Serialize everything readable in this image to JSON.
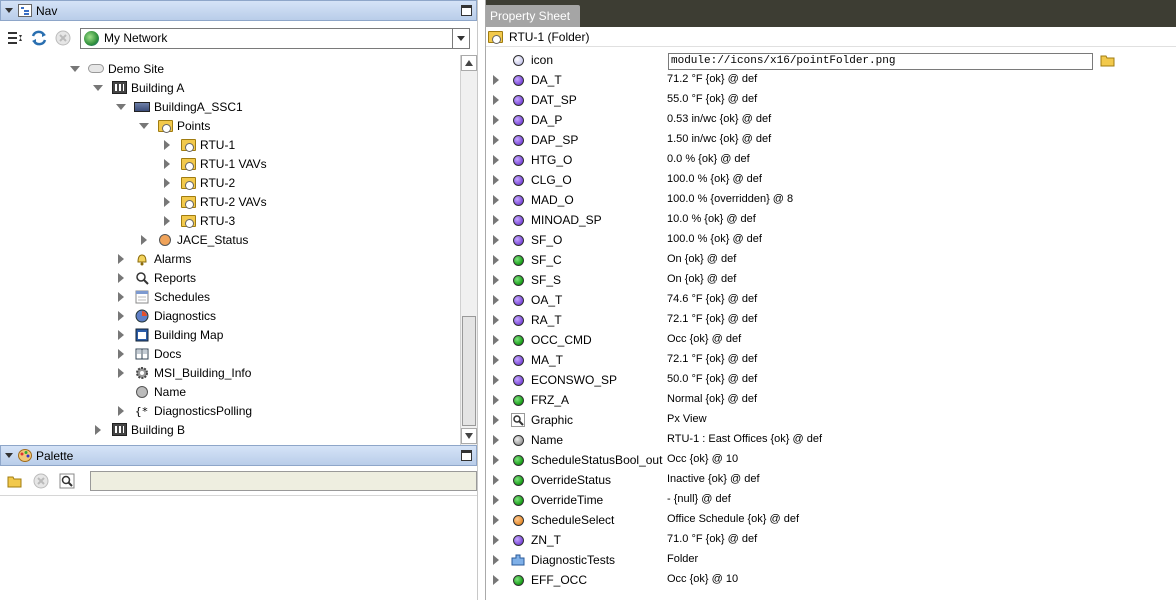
{
  "nav": {
    "title": "Nav",
    "network_label": "My Network",
    "tree": [
      {
        "label": "Demo Site",
        "indent": 0,
        "twisty": "open",
        "icon": "cloud-icon"
      },
      {
        "label": "Building A",
        "indent": 1,
        "twisty": "open",
        "icon": "building-icon"
      },
      {
        "label": "BuildingA_SSC1",
        "indent": 2,
        "twisty": "open",
        "icon": "station-icon"
      },
      {
        "label": "Points",
        "indent": 3,
        "twisty": "open",
        "icon": "folder-icon"
      },
      {
        "label": "RTU-1",
        "indent": 4,
        "twisty": "closed",
        "icon": "folder-icon"
      },
      {
        "label": "RTU-1 VAVs",
        "indent": 4,
        "twisty": "closed",
        "icon": "folder-icon"
      },
      {
        "label": "RTU-2",
        "indent": 4,
        "twisty": "closed",
        "icon": "folder-icon"
      },
      {
        "label": "RTU-2 VAVs",
        "indent": 4,
        "twisty": "closed",
        "icon": "folder-icon"
      },
      {
        "label": "RTU-3",
        "indent": 4,
        "twisty": "closed",
        "icon": "folder-icon"
      },
      {
        "label": "JACE_Status",
        "indent": 3,
        "twisty": "closed",
        "icon": "orange-dot-icon"
      },
      {
        "label": "Alarms",
        "indent": 2,
        "twisty": "closed",
        "icon": "bell-icon"
      },
      {
        "label": "Reports",
        "indent": 2,
        "twisty": "closed",
        "icon": "magnifier-icon"
      },
      {
        "label": "Schedules",
        "indent": 2,
        "twisty": "closed",
        "icon": "calendar-icon"
      },
      {
        "label": "Diagnostics",
        "indent": 2,
        "twisty": "closed",
        "icon": "clock-icon"
      },
      {
        "label": "Building Map",
        "indent": 2,
        "twisty": "closed",
        "icon": "map-icon"
      },
      {
        "label": "Docs",
        "indent": 2,
        "twisty": "closed",
        "icon": "book-icon"
      },
      {
        "label": "MSI_Building_Info",
        "indent": 2,
        "twisty": "closed",
        "icon": "gear-icon"
      },
      {
        "label": "Name",
        "indent": 2,
        "twisty": "none",
        "icon": "gray-dot-icon"
      },
      {
        "label": "DiagnosticsPolling",
        "indent": 2,
        "twisty": "closed",
        "icon": "program-icon"
      },
      {
        "label": "Building B",
        "indent": 1,
        "twisty": "closed",
        "icon": "building-icon"
      }
    ]
  },
  "palette": {
    "title": "Palette",
    "search_value": ""
  },
  "property_sheet": {
    "tab_label": "Property Sheet",
    "title": "RTU-1  (Folder)",
    "icon_row": {
      "name": "icon",
      "value": "module://icons/x16/pointFolder.png"
    },
    "rows": [
      {
        "name": "DA_T",
        "value": "71.2 °F {ok} @ def",
        "dot": "purple"
      },
      {
        "name": "DAT_SP",
        "value": "55.0 °F {ok} @ def",
        "dot": "purple"
      },
      {
        "name": "DA_P",
        "value": "0.53 in/wc {ok} @ def",
        "dot": "purple"
      },
      {
        "name": "DAP_SP",
        "value": "1.50 in/wc {ok} @ def",
        "dot": "purple"
      },
      {
        "name": "HTG_O",
        "value": "0.0 % {ok} @ def",
        "dot": "purple"
      },
      {
        "name": "CLG_O",
        "value": "100.0 % {ok} @ def",
        "dot": "purple"
      },
      {
        "name": "MAD_O",
        "value": "100.0 % {overridden} @ 8",
        "dot": "purple"
      },
      {
        "name": "MINOAD_SP",
        "value": "10.0 % {ok} @ def",
        "dot": "purple"
      },
      {
        "name": "SF_O",
        "value": "100.0 % {ok} @ def",
        "dot": "purple"
      },
      {
        "name": "SF_C",
        "value": "On {ok} @ def",
        "dot": "green"
      },
      {
        "name": "SF_S",
        "value": "On {ok} @ def",
        "dot": "green"
      },
      {
        "name": "OA_T",
        "value": "74.6 °F {ok} @ def",
        "dot": "purple"
      },
      {
        "name": "RA_T",
        "value": "72.1 °F {ok} @ def",
        "dot": "purple"
      },
      {
        "name": "OCC_CMD",
        "value": "Occ {ok} @ def",
        "dot": "green"
      },
      {
        "name": "MA_T",
        "value": "72.1 °F {ok} @ def",
        "dot": "purple"
      },
      {
        "name": "ECONSWO_SP",
        "value": "50.0 °F {ok} @ def",
        "dot": "purple"
      },
      {
        "name": "FRZ_A",
        "value": "Normal {ok} @ def",
        "dot": "green"
      },
      {
        "name": "Graphic",
        "value": "Px View",
        "dot": "magnifier"
      },
      {
        "name": "Name",
        "value": "RTU-1 : East Offices {ok} @ def",
        "dot": "gray"
      },
      {
        "name": "ScheduleStatusBool_out",
        "value": "Occ {ok} @ 10",
        "dot": "green"
      },
      {
        "name": "OverrideStatus",
        "value": "Inactive {ok} @ def",
        "dot": "green"
      },
      {
        "name": "OverrideTime",
        "value": "- {null} @ def",
        "dot": "green"
      },
      {
        "name": "ScheduleSelect",
        "value": "Office Schedule {ok} @ def",
        "dot": "orange"
      },
      {
        "name": "ZN_T",
        "value": "71.0 °F {ok} @ def",
        "dot": "purple"
      },
      {
        "name": "DiagnosticTests",
        "value": "Folder",
        "dot": "puzzle"
      },
      {
        "name": "EFF_OCC",
        "value": "Occ {ok} @ 10",
        "dot": "green"
      }
    ]
  },
  "colors": {
    "tab_strip": "#3d3d33",
    "tab_active": "#a5a5a5",
    "header_bg": "#c7d7ef"
  }
}
